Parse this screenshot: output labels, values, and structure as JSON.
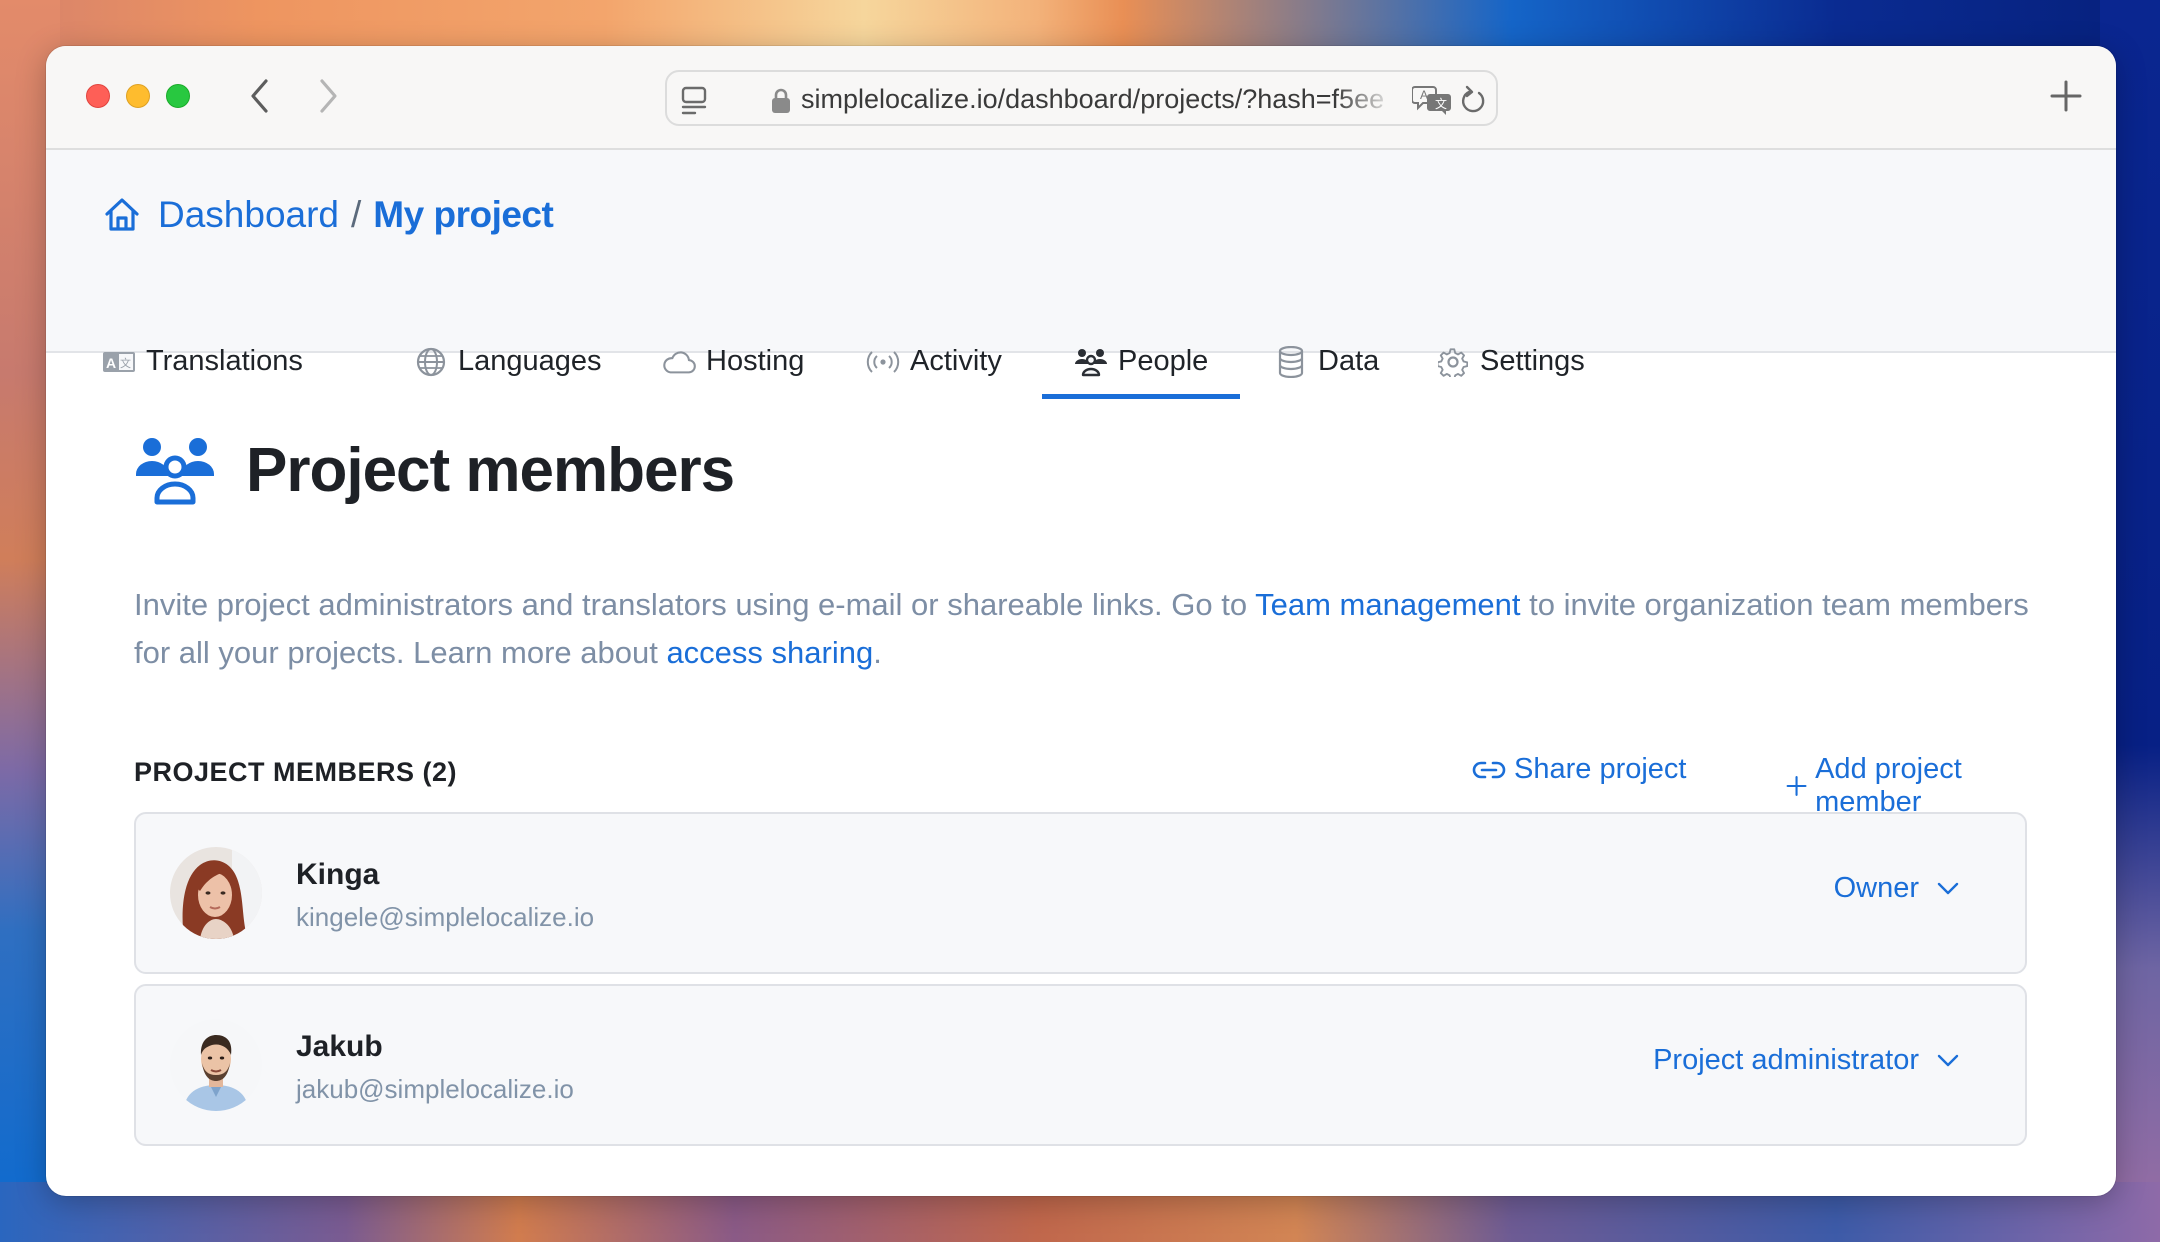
{
  "browser": {
    "url": "simplelocalize.io/dashboard/projects/?hash=f5ee",
    "icons": [
      "sidebar-icon",
      "lock-icon",
      "translate-icon",
      "reload-icon",
      "new-tab-icon",
      "back-icon",
      "forward-icon"
    ]
  },
  "breadcrumb": {
    "home_label": "Dashboard",
    "separator": "/",
    "current": "My project"
  },
  "tabs": [
    {
      "label": "Translations",
      "icon": "translations-icon",
      "active": false
    },
    {
      "label": "Languages",
      "icon": "globe-icon",
      "active": false
    },
    {
      "label": "Hosting",
      "icon": "cloud-icon",
      "active": false
    },
    {
      "label": "Activity",
      "icon": "broadcast-icon",
      "active": false
    },
    {
      "label": "People",
      "icon": "people-icon",
      "active": true
    },
    {
      "label": "Data",
      "icon": "database-icon",
      "active": false
    },
    {
      "label": "Settings",
      "icon": "gear-icon",
      "active": false
    }
  ],
  "page": {
    "title": "Project members",
    "description": {
      "part1": "Invite project administrators and translators using e-mail or shareable links. Go to ",
      "link1": "Team management",
      "part2": " to invite organization team members for all your projects. Learn more about ",
      "link2": "access sharing",
      "part3": "."
    }
  },
  "members": {
    "header": "PROJECT MEMBERS (2)",
    "share_label": "Share project",
    "add_label": "Add project member",
    "list": [
      {
        "name": "Kinga",
        "email": "kingele@simplelocalize.io",
        "role": "Owner"
      },
      {
        "name": "Jakub",
        "email": "jakub@simplelocalize.io",
        "role": "Project administrator"
      }
    ]
  },
  "colors": {
    "accent": "#1a6ed8",
    "text": "#1e2126",
    "muted": "#7d8ea5",
    "card_bg": "#f7f8fa",
    "card_border": "#dfe1e6"
  }
}
